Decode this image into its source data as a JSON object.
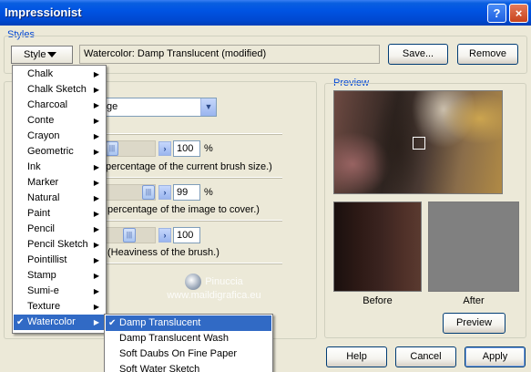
{
  "window": {
    "title": "Impressionist",
    "help_glyph": "?",
    "close_glyph": "×"
  },
  "styles": {
    "group_label": "Styles",
    "style_button_label": "Style",
    "current_style": "Watercolor: Damp Translucent (modified)",
    "save_label": "Save...",
    "remove_label": "Remove"
  },
  "controls": {
    "combo_value": "ge",
    "rows": [
      {
        "value": "100",
        "unit": "%",
        "desc": "percentage of the current brush size.)"
      },
      {
        "value": "99",
        "unit": "%",
        "desc": "percentage of the image to cover.)"
      },
      {
        "value": "100",
        "unit": "",
        "desc": "(Heaviness of the brush.)"
      }
    ]
  },
  "preview": {
    "group_label": "Preview",
    "before_label": "Before",
    "after_label": "After",
    "preview_button": "Preview"
  },
  "footer": {
    "help": "Help",
    "cancel": "Cancel",
    "apply": "Apply"
  },
  "watermark": {
    "name": "Pinuccia",
    "url": "www.maildigrafica.eu"
  },
  "style_menu": {
    "items": [
      {
        "label": "Chalk",
        "submenu": true
      },
      {
        "label": "Chalk Sketch",
        "submenu": true
      },
      {
        "label": "Charcoal",
        "submenu": true
      },
      {
        "label": "Conte",
        "submenu": true
      },
      {
        "label": "Crayon",
        "submenu": true
      },
      {
        "label": "Geometric",
        "submenu": true
      },
      {
        "label": "Ink",
        "submenu": true
      },
      {
        "label": "Marker",
        "submenu": true
      },
      {
        "label": "Natural",
        "submenu": true
      },
      {
        "label": "Paint",
        "submenu": true
      },
      {
        "label": "Pencil",
        "submenu": true
      },
      {
        "label": "Pencil Sketch",
        "submenu": true
      },
      {
        "label": "Pointillist",
        "submenu": true
      },
      {
        "label": "Stamp",
        "submenu": true
      },
      {
        "label": "Sumi-e",
        "submenu": true
      },
      {
        "label": "Texture",
        "submenu": true
      },
      {
        "label": "Watercolor",
        "submenu": true,
        "checked": true,
        "highlighted": true
      }
    ]
  },
  "watercolor_submenu": {
    "items": [
      {
        "label": "Damp Translucent",
        "checked": true,
        "highlighted": true
      },
      {
        "label": "Damp Translucent Wash"
      },
      {
        "label": "Soft Daubs On Fine Paper"
      },
      {
        "label": "Soft Water Sketch"
      }
    ]
  },
  "colors": {
    "title_bar": "#0054e3",
    "highlight": "#316ac5",
    "group_label": "#0046d5"
  }
}
